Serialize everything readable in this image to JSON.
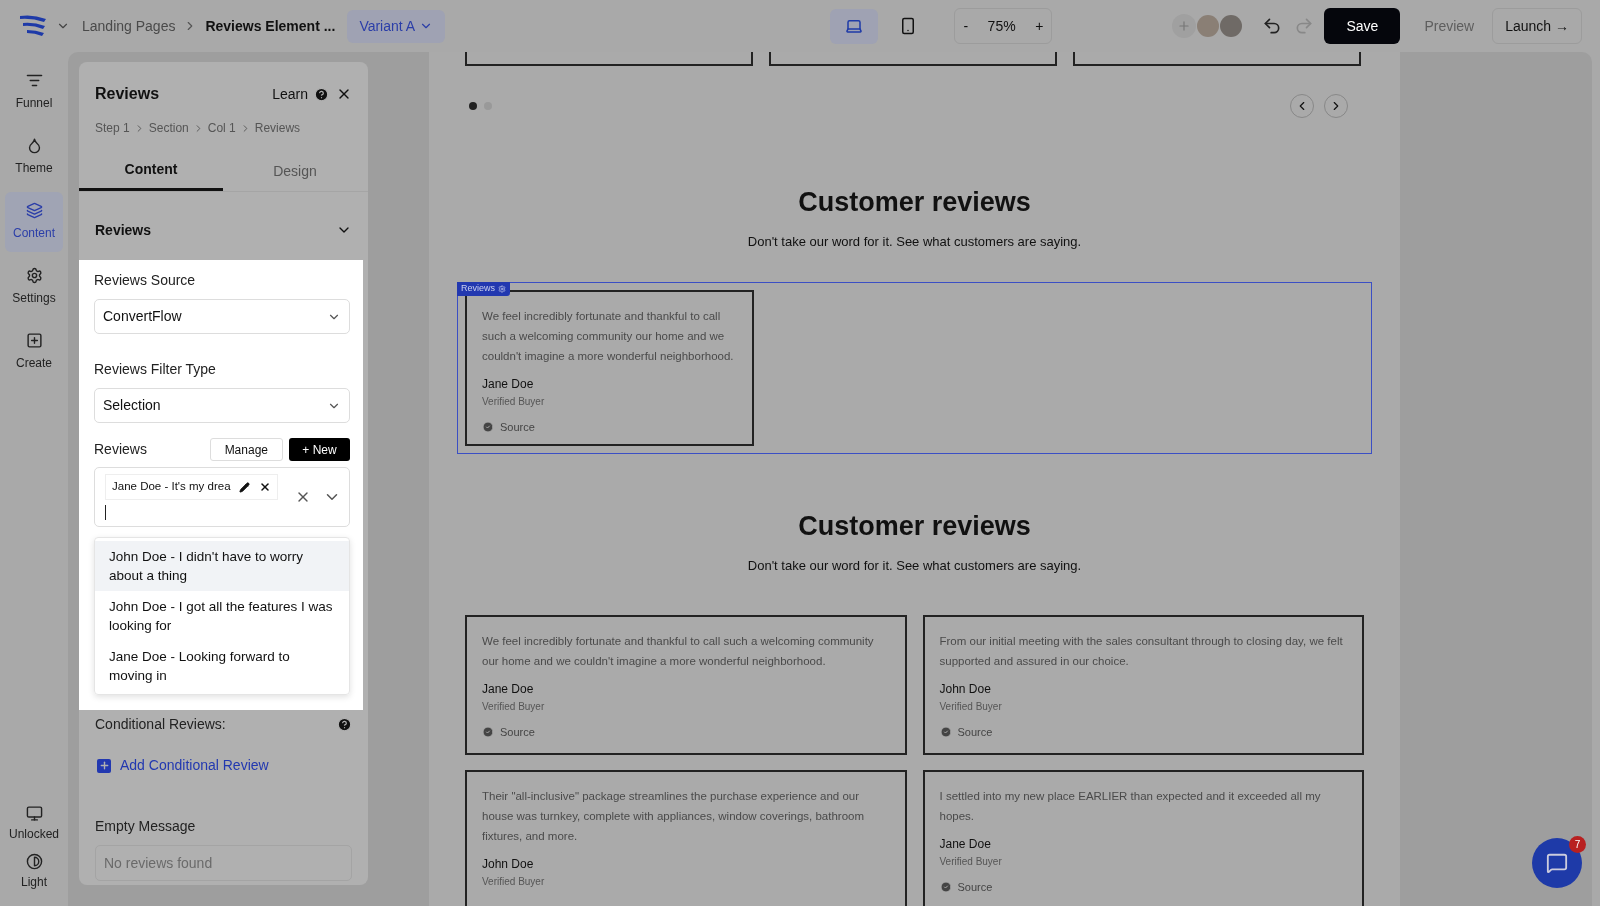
{
  "topbar": {
    "breadcrumb": [
      "Landing Pages",
      "Reviews Element ..."
    ],
    "variant": "Variant A",
    "devices": [
      {
        "kind": "desktop",
        "selected": true
      },
      {
        "kind": "mobile",
        "selected": false
      }
    ],
    "zoom": {
      "minus": "-",
      "value": "75%",
      "plus": "+"
    },
    "save": "Save",
    "preview": {
      "label": "Preview",
      "disabled": true
    },
    "launch": "Launch →"
  },
  "rail": {
    "items": [
      {
        "kind": "funnel",
        "label": "Funnel",
        "selected": false
      },
      {
        "kind": "theme",
        "label": "Theme",
        "selected": false
      },
      {
        "kind": "content",
        "label": "Content",
        "selected": true
      },
      {
        "kind": "settings",
        "label": "Settings",
        "selected": false
      },
      {
        "kind": "create",
        "label": "Create",
        "selected": false
      }
    ],
    "bottom": [
      {
        "kind": "monitor",
        "label": "Unlocked"
      },
      {
        "kind": "contrast",
        "label": "Light"
      }
    ]
  },
  "panel": {
    "title": "Reviews",
    "learn": "Learn",
    "breadcrumb": [
      "Step 1",
      "Section",
      "Col 1",
      "Reviews"
    ],
    "tabs": [
      {
        "label": "Content",
        "selected": true
      },
      {
        "label": "Design",
        "selected": false
      }
    ],
    "section": {
      "title": "Reviews",
      "expanded": true
    },
    "source": {
      "label": "Reviews Source",
      "value": "ConvertFlow"
    },
    "filter": {
      "label": "Reviews Filter Type",
      "value": "Selection"
    },
    "reviews": {
      "label": "Reviews",
      "manage": "Manage",
      "new": "+ New",
      "chips": [
        "Jane Doe - It's my drea"
      ],
      "options": [
        {
          "label": "John Doe - I didn't have to worry about a thing",
          "highlighted": true
        },
        {
          "label": "John Doe - I got all the features I was looking for",
          "highlighted": false
        },
        {
          "label": "Jane Doe - Looking forward to moving in",
          "highlighted": false
        }
      ]
    },
    "conditional": {
      "label": "Conditional Reviews:",
      "add": "Add Conditional Review"
    },
    "empty": {
      "label": "Empty Message",
      "placeholder": "No reviews found"
    }
  },
  "canvas": {
    "dots": [
      {
        "selected": true
      },
      {
        "selected": false
      }
    ],
    "sections": [
      {
        "heading": "Customer reviews",
        "subtitle": "Don't take our word for it. See what customers are saying.",
        "selected_label": "Reviews",
        "kind": "carousel",
        "cards": [
          {
            "text": "We feel incredibly fortunate and thankful to call such a welcoming community our home and we couldn't imagine a more wonderful neighborhood.",
            "name": "Jane Doe",
            "role": "Verified Buyer",
            "source": "Source"
          }
        ]
      },
      {
        "heading": "Customer reviews",
        "subtitle": "Don't take our word for it. See what customers are saying.",
        "kind": "grid",
        "cards": [
          {
            "text": "We feel incredibly fortunate and thankful to call such a welcoming community our home and we couldn't imagine a more wonderful neighborhood.",
            "name": "Jane Doe",
            "role": "Verified Buyer",
            "source": "Source"
          },
          {
            "text": "From our initial meeting with the sales consultant through to closing day, we felt supported and assured in our choice.",
            "name": "John Doe",
            "role": "Verified Buyer",
            "source": "Source"
          },
          {
            "text": "Their \"all-inclusive\" package streamlines the purchase experience and our house was turnkey, complete with appliances, window coverings, bathroom fixtures, and more.",
            "name": "John Doe",
            "role": "Verified Buyer"
          },
          {
            "text": "I settled into my new place EARLIER than expected and it exceeded all my hopes.",
            "name": "Jane Doe",
            "role": "Verified Buyer",
            "source": "Source"
          }
        ]
      }
    ]
  },
  "chat": {
    "badge": "7"
  }
}
